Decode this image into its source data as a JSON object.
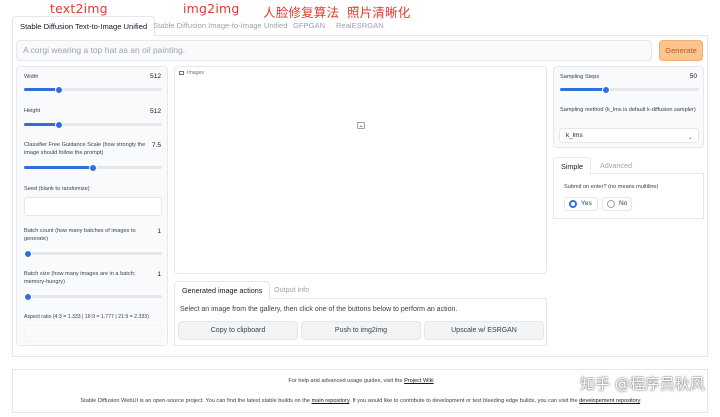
{
  "annotations": {
    "text2img": "text2img",
    "img2img": "img2img",
    "face_restore": "人脸修复算法",
    "upscale": "照片清晰化"
  },
  "tabs": [
    {
      "label": "Stable Diffusion Text-to-Image Unified",
      "active": true
    },
    {
      "label": "Stable Diffusion Image-to-Image Unified",
      "active": false
    },
    {
      "label": "GFPGAN",
      "active": false
    },
    {
      "label": "RealESRGAN",
      "active": false
    }
  ],
  "prompt": {
    "placeholder": "A corgi wearing a top hat as an oil painting.",
    "value": ""
  },
  "generate_label": "Generate",
  "left": {
    "width": {
      "label": "Width",
      "value": "512",
      "fill": 0.25
    },
    "height": {
      "label": "Height",
      "value": "512",
      "fill": 0.25
    },
    "cfg": {
      "label": "Classifier Free Guidance Scale (how strongly the image should follow the prompt)",
      "value": "7.5",
      "fill": 0.5
    },
    "seed": {
      "label": "Seed (blank to randomize)",
      "value": ""
    },
    "batch_count": {
      "label": "Batch count (how many batches of images to generate)",
      "value": "1",
      "fill": 0.0
    },
    "batch_size": {
      "label": "Batch size (how many images are in a batch; memory-hungry)",
      "value": "1",
      "fill": 0.0
    },
    "aspect": {
      "label": "Aspect ratio (4:3 = 1.333 | 16:9 = 1.777 | 21:9 = 2.333)",
      "value": ""
    }
  },
  "image_panel": {
    "label": "Images"
  },
  "subtabs": [
    {
      "label": "Generated image actions",
      "active": true
    },
    {
      "label": "Output info",
      "active": false
    }
  ],
  "actions": {
    "info": "Select an image from the gallery, then click one of the buttons below to perform an action.",
    "buttons": [
      "Copy to clipboard",
      "Push to img2img",
      "Upscale w/ ESRGAN"
    ]
  },
  "right": {
    "steps": {
      "label": "Sampling Steps",
      "value": "50",
      "fill": 0.33
    },
    "method": {
      "label": "Sampling method (k_lms is default k-diffusion sampler)",
      "value": "k_lms"
    },
    "tabs": [
      {
        "label": "Simple",
        "active": true
      },
      {
        "label": "Advanced",
        "active": false
      }
    ],
    "submit": {
      "label": "Submit on enter? (no means multiline)",
      "yes": "Yes",
      "no": "No",
      "selected": "Yes"
    }
  },
  "footer": {
    "line1_prefix": "For help and advanced usage guides, visit the ",
    "line1_link": "Project Wiki",
    "line2_a": "Stable Diffusion WebUI is an open-source project. You can find the latest stable builds on the ",
    "line2_link1": "main repository",
    "line2_b": ". If you would like to contribute to development or test bleeding edge builds, you can visit the ",
    "line2_link2": "developement repository",
    "line2_c": "."
  },
  "watermark": "知乎 @程序员秋风",
  "colors": {
    "accent": "#2f6fdc",
    "generate_bg": "#fcc48f",
    "annotation": "#e23a2e"
  }
}
